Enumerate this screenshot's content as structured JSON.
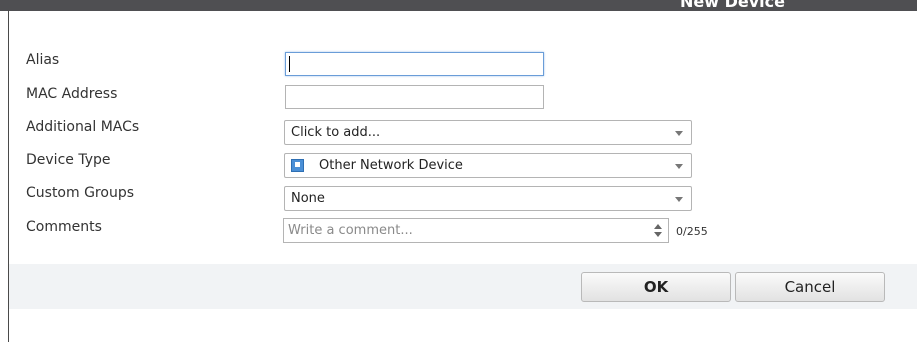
{
  "dialog": {
    "title": "New Device"
  },
  "form": {
    "alias": {
      "label": "Alias",
      "value": ""
    },
    "mac_address": {
      "label": "MAC Address",
      "value": ""
    },
    "additional_macs": {
      "label": "Additional MACs",
      "selected": "Click to add..."
    },
    "device_type": {
      "label": "Device Type",
      "selected": "Other Network Device",
      "icon": "network-device-icon"
    },
    "custom_groups": {
      "label": "Custom Groups",
      "selected": "None"
    },
    "comments": {
      "label": "Comments",
      "placeholder": "Write a comment...",
      "counter": "0/255"
    }
  },
  "buttons": {
    "ok": "OK",
    "cancel": "Cancel"
  },
  "colors": {
    "titlebar": "#4f4f52",
    "footer": "#f1f3f5",
    "focus_border": "#6a9dd8",
    "device_icon": "#4a8fd6"
  }
}
